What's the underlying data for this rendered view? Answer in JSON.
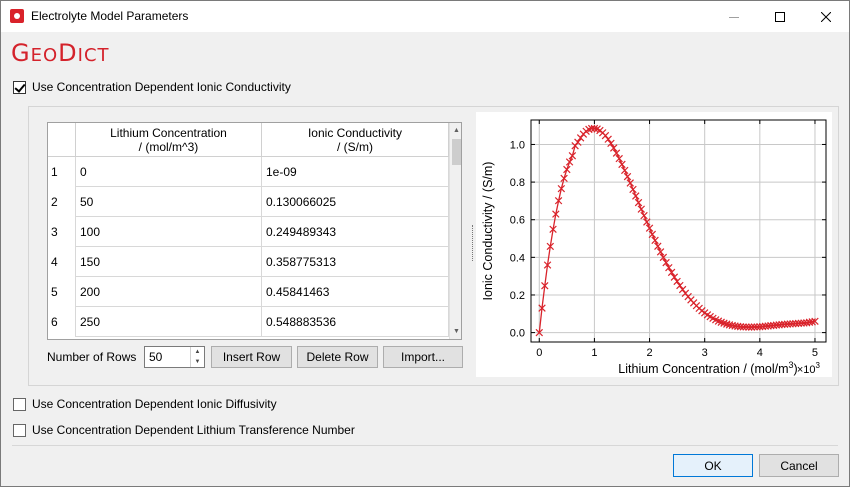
{
  "window": {
    "title": "Electrolyte Model Parameters",
    "minimize_icon": "minimize-icon",
    "maximize_icon": "maximize-icon",
    "close_icon": "close-icon"
  },
  "logo": {
    "first_big": "G",
    "first_small": "EO",
    "second_big": "D",
    "second_small": "ICT",
    "color": "#d4222b"
  },
  "options": {
    "conductivity": {
      "label": "Use Concentration Dependent Ionic Conductivity",
      "checked": true
    },
    "diffusivity": {
      "label": "Use Concentration Dependent Ionic Diffusivity",
      "checked": false
    },
    "transference": {
      "label": "Use Concentration Dependent Lithium Transference Number",
      "checked": false
    }
  },
  "table": {
    "columns": [
      "Lithium Concentration\n/ (mol/m^3)",
      "Ionic Conductivity\n/ (S/m)"
    ],
    "rows": [
      [
        "1",
        "0",
        "1e-09"
      ],
      [
        "2",
        "50",
        "0.130066025"
      ],
      [
        "3",
        "100",
        "0.249489343"
      ],
      [
        "4",
        "150",
        "0.358775313"
      ],
      [
        "5",
        "200",
        "0.45841463"
      ],
      [
        "6",
        "250",
        "0.548883536"
      ]
    ]
  },
  "row_controls": {
    "num_rows_label": "Number of Rows",
    "num_rows_value": "50",
    "insert_label": "Insert Row",
    "delete_label": "Delete Row",
    "import_label": "Import..."
  },
  "dialog": {
    "ok_label": "OK",
    "cancel_label": "Cancel"
  },
  "chart_data": {
    "type": "line",
    "xlabel_prefix": "Lithium Concentration / (mol/m",
    "xlabel_sup": "3",
    "xlabel_suffix": ")",
    "ylabel": "Ionic Conductivity / (S/m)",
    "x_multiplier_label": "×10",
    "x_multiplier_sup": "3",
    "xlim": [
      -0.15,
      5.2
    ],
    "ylim": [
      -0.05,
      1.13
    ],
    "xticks": [
      0,
      1,
      2,
      3,
      4,
      5
    ],
    "xtick_labels": [
      "0",
      "1",
      "2",
      "3",
      "4",
      "5"
    ],
    "yticks": [
      0.0,
      0.2,
      0.4,
      0.6,
      0.8,
      1.0
    ],
    "ytick_labels": [
      "0.0",
      "0.2",
      "0.4",
      "0.6",
      "0.8",
      "1.0"
    ],
    "grid": true,
    "series_color": "#d9232b",
    "marker": "x",
    "x": [
      0,
      0.05,
      0.1,
      0.15,
      0.2,
      0.25,
      0.3,
      0.35,
      0.4,
      0.45,
      0.5,
      0.55,
      0.6,
      0.65,
      0.7,
      0.75,
      0.8,
      0.85,
      0.9,
      0.95,
      1.0,
      1.05,
      1.1,
      1.15,
      1.2,
      1.25,
      1.3,
      1.35,
      1.4,
      1.45,
      1.5,
      1.55,
      1.6,
      1.65,
      1.7,
      1.75,
      1.8,
      1.85,
      1.9,
      1.95,
      2.0,
      2.05,
      2.1,
      2.15,
      2.2,
      2.25,
      2.3,
      2.35,
      2.4,
      2.45,
      2.5,
      2.55,
      2.6,
      2.65,
      2.7,
      2.75,
      2.8,
      2.85,
      2.9,
      2.95,
      3.0,
      3.05,
      3.1,
      3.15,
      3.2,
      3.25,
      3.3,
      3.35,
      3.4,
      3.45,
      3.5,
      3.55,
      3.6,
      3.65,
      3.7,
      3.75,
      3.8,
      3.85,
      3.9,
      3.95,
      4.0,
      4.05,
      4.1,
      4.15,
      4.2,
      4.25,
      4.3,
      4.35,
      4.4,
      4.45,
      4.5,
      4.55,
      4.6,
      4.65,
      4.7,
      4.75,
      4.8,
      4.85,
      4.9,
      4.95,
      5.0
    ],
    "y": [
      0.0,
      0.13,
      0.249,
      0.359,
      0.458,
      0.549,
      0.63,
      0.701,
      0.765,
      0.82,
      0.867,
      0.907,
      0.94,
      0.993,
      1.012,
      1.035,
      1.055,
      1.07,
      1.08,
      1.085,
      1.085,
      1.082,
      1.074,
      1.062,
      1.047,
      1.028,
      1.006,
      0.981,
      0.954,
      0.925,
      0.894,
      0.862,
      0.829,
      0.795,
      0.761,
      0.726,
      0.691,
      0.656,
      0.622,
      0.588,
      0.555,
      0.522,
      0.49,
      0.459,
      0.429,
      0.4,
      0.372,
      0.345,
      0.32,
      0.295,
      0.272,
      0.25,
      0.229,
      0.209,
      0.191,
      0.174,
      0.158,
      0.143,
      0.129,
      0.116,
      0.105,
      0.094,
      0.085,
      0.076,
      0.068,
      0.061,
      0.055,
      0.05,
      0.045,
      0.041,
      0.038,
      0.035,
      0.033,
      0.031,
      0.03,
      0.03,
      0.029,
      0.029,
      0.03,
      0.03,
      0.031,
      0.032,
      0.034,
      0.035,
      0.037,
      0.038,
      0.04,
      0.041,
      0.043,
      0.044,
      0.045,
      0.046,
      0.047,
      0.048,
      0.049,
      0.05,
      0.051,
      0.052,
      0.055,
      0.057,
      0.06
    ]
  }
}
